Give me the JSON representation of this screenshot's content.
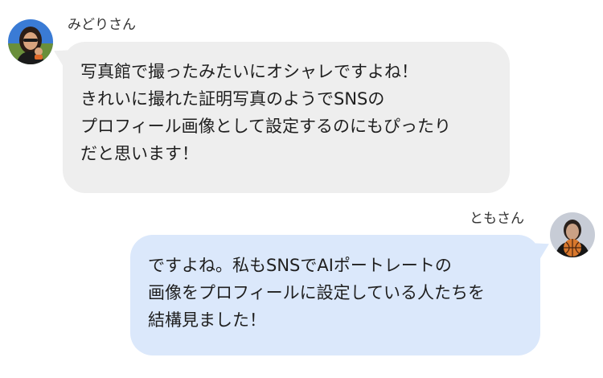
{
  "messages": [
    {
      "sender": "みどりさん",
      "side": "left",
      "avatar_icon": "user-photo-avatar",
      "bubble_color": "#eeeeee",
      "lines": [
        "写真館で撮ったみたいにオシャレですよね！",
        "きれいに撮れた証明写真のようでSNSの",
        "プロフィール画像として設定するのにもぴったり",
        "だと思います！"
      ]
    },
    {
      "sender": "ともさん",
      "side": "right",
      "avatar_icon": "user-photo-avatar-basketball",
      "bubble_color": "#dbe8fb",
      "lines": [
        "ですよね。私もSNSでAIポートレートの",
        "画像をプロフィールに設定している人たちを",
        "結構見ました！"
      ]
    }
  ]
}
